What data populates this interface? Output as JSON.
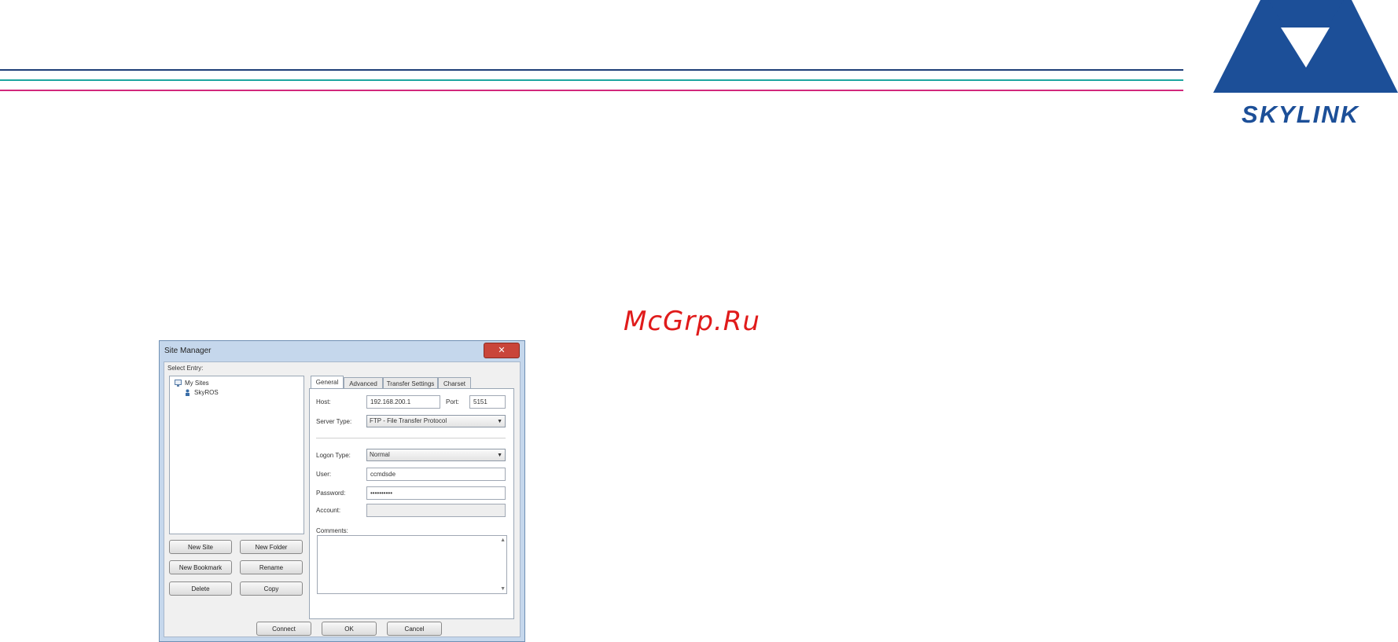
{
  "brand": {
    "name": "SKYLINK",
    "color": "#1c4f98"
  },
  "header_lines": {
    "colors": [
      "#1f3f78",
      "#1ea6a0",
      "#d2287c"
    ]
  },
  "watermark": "McGrp.Ru",
  "dialog": {
    "title": "Site Manager",
    "close_label": "✕",
    "select_entry_label": "Select Entry:",
    "tree": {
      "root": "My Sites",
      "child": "SkyROS"
    },
    "buttons": {
      "new_site": "New Site",
      "new_folder": "New Folder",
      "new_bookmark": "New Bookmark",
      "rename": "Rename",
      "delete": "Delete",
      "copy": "Copy",
      "connect": "Connect",
      "ok": "OK",
      "cancel": "Cancel"
    },
    "tabs": [
      "General",
      "Advanced",
      "Transfer Settings",
      "Charset"
    ],
    "general": {
      "host_label": "Host:",
      "host_value": "192.168.200.1",
      "port_label": "Port:",
      "port_value": "5151",
      "server_type_label": "Server Type:",
      "server_type_value": "FTP - File Transfer Protocol",
      "logon_type_label": "Logon Type:",
      "logon_type_value": "Normal",
      "user_label": "User:",
      "user_value": "ccmdsde",
      "password_label": "Password:",
      "password_value": "••••••••••",
      "account_label": "Account:",
      "account_value": "",
      "comments_label": "Comments:"
    }
  }
}
